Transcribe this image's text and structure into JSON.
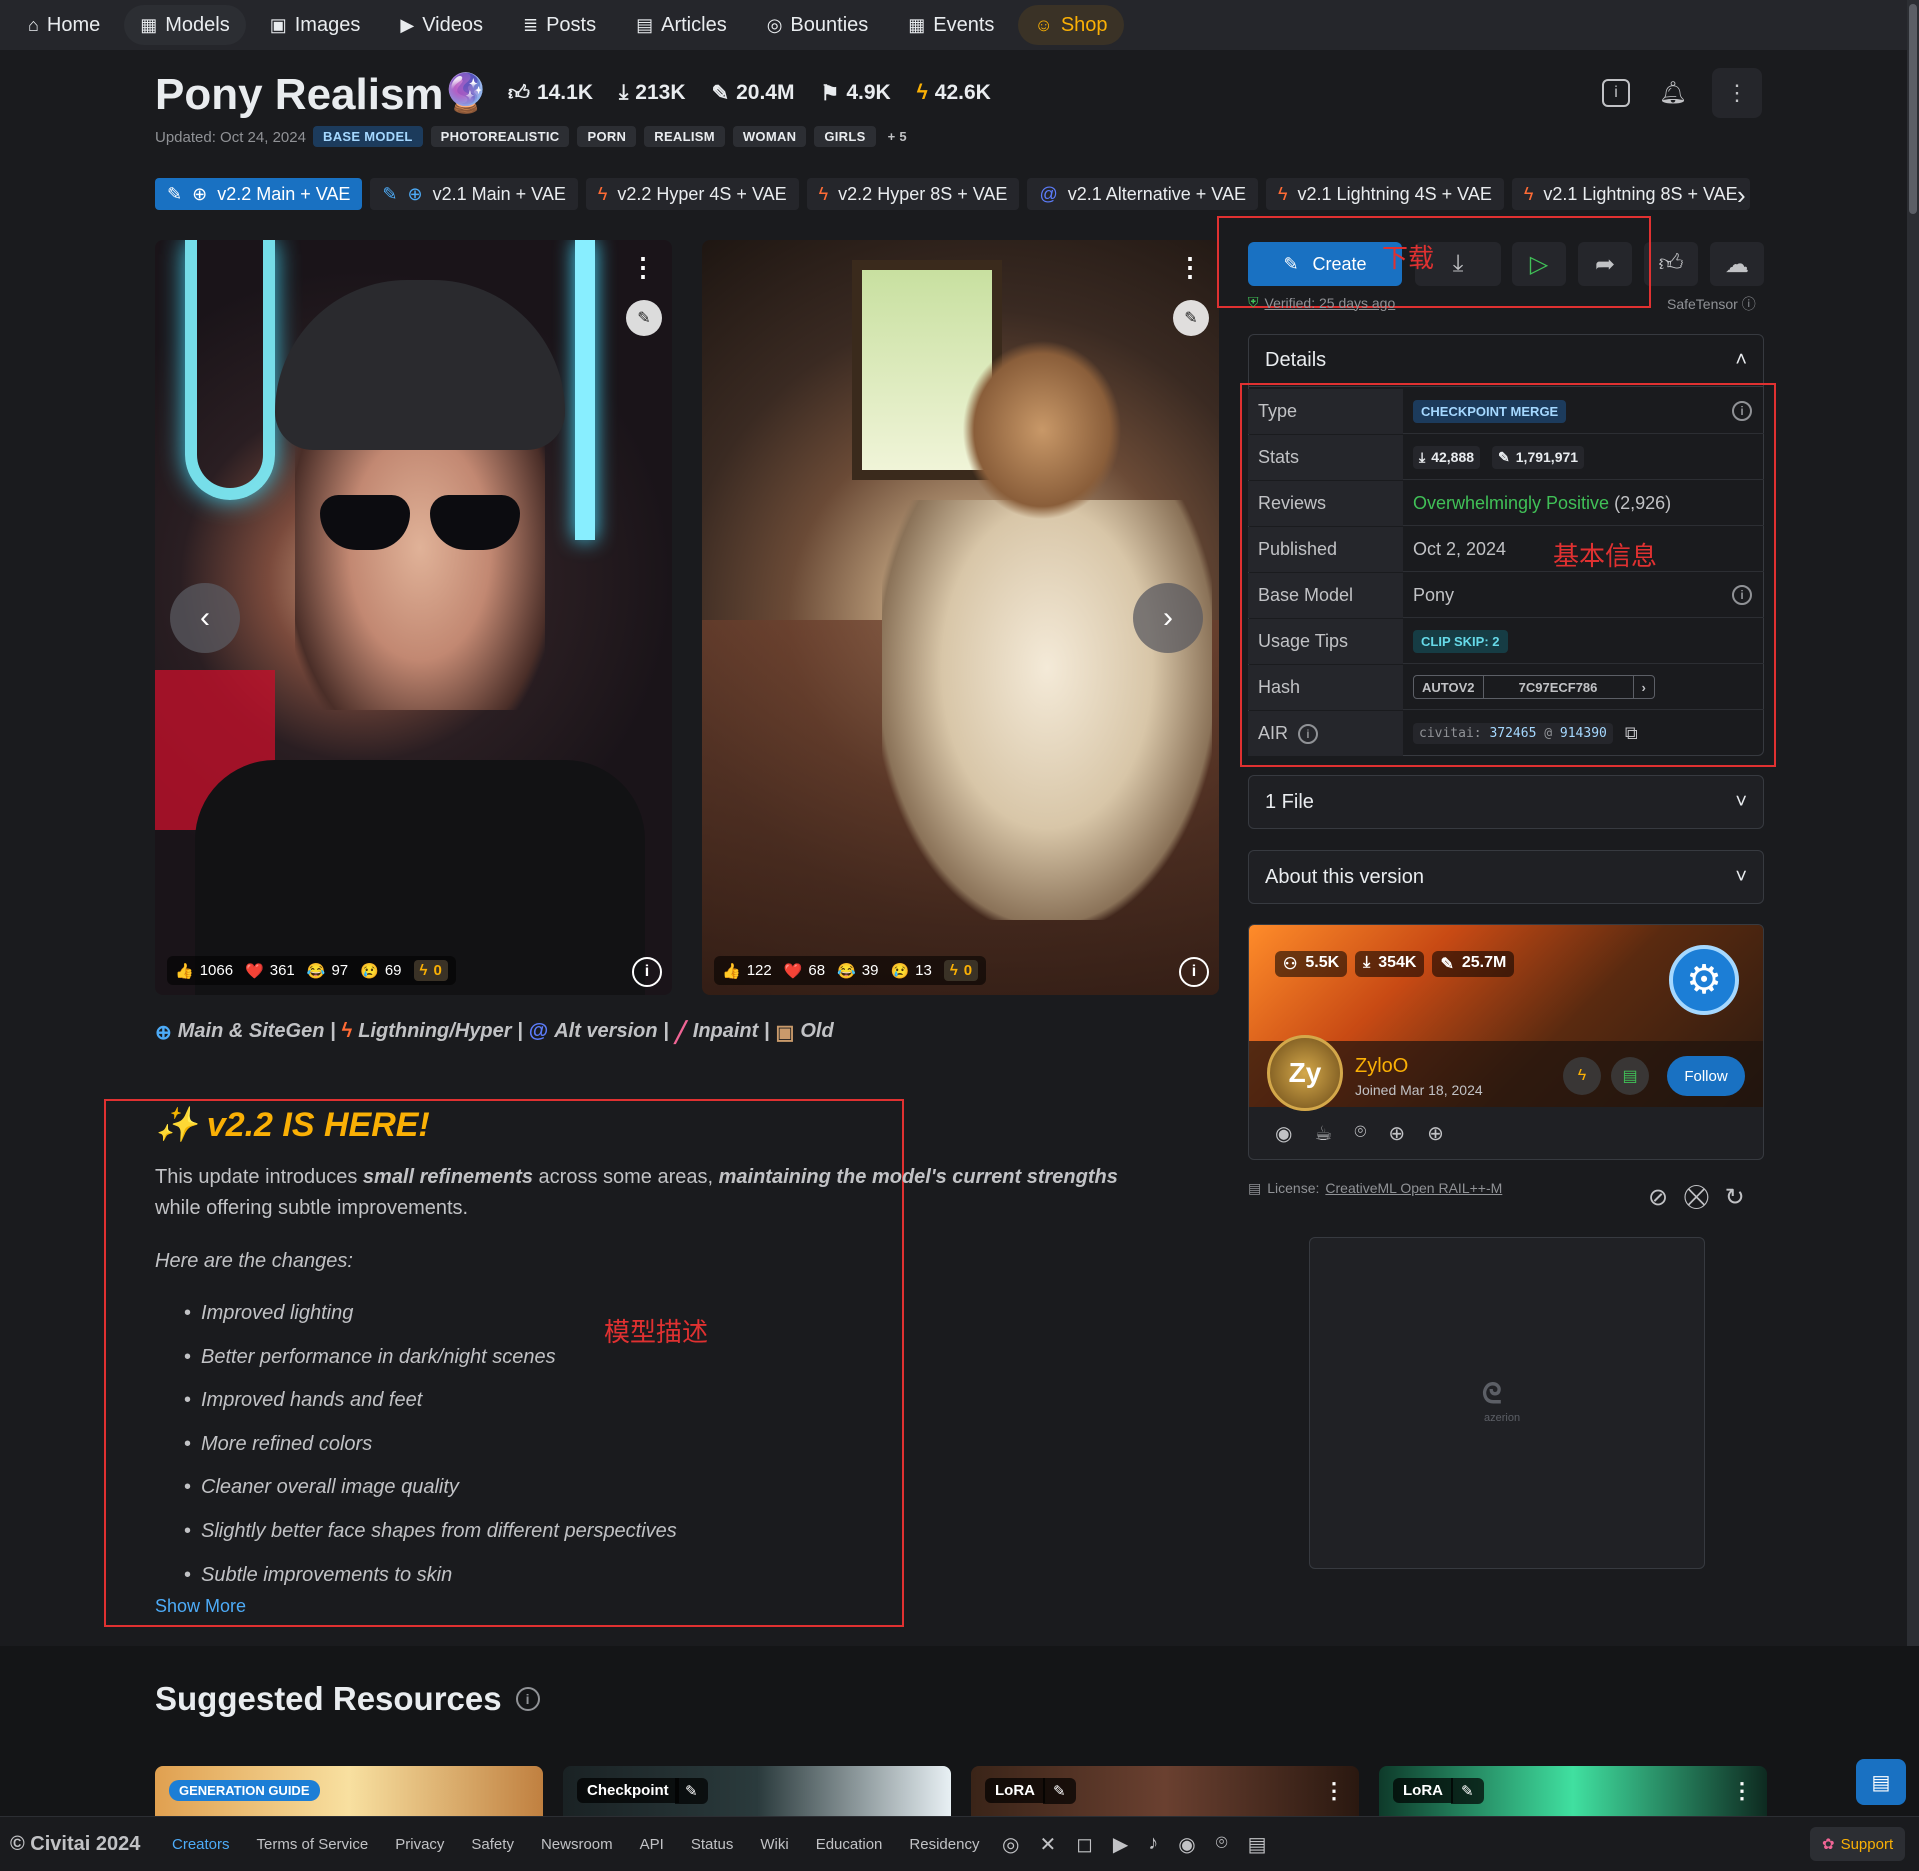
{
  "nav": [
    {
      "icon": "home-icon",
      "glyph": "⌂",
      "label": "Home"
    },
    {
      "icon": "grid-icon",
      "glyph": "▦",
      "label": "Models"
    },
    {
      "icon": "image-icon",
      "glyph": "▣",
      "label": "Images"
    },
    {
      "icon": "video-icon",
      "glyph": "▶",
      "label": "Videos"
    },
    {
      "icon": "posts-icon",
      "glyph": "≣",
      "label": "Posts"
    },
    {
      "icon": "article-icon",
      "glyph": "▤",
      "label": "Articles"
    },
    {
      "icon": "bounty-icon",
      "glyph": "◎",
      "label": "Bounties"
    },
    {
      "icon": "calendar-icon",
      "glyph": "▦",
      "label": "Events"
    },
    {
      "icon": "shop-icon",
      "glyph": "☺",
      "label": "Shop"
    }
  ],
  "model": {
    "title": "Pony Realism",
    "stats": {
      "likes": "14.1K",
      "downloads": "213K",
      "generations": "20.4M",
      "collected": "4.9K",
      "buzz": "42.6K"
    },
    "updated": "Updated: Oct 24, 2024",
    "tags": [
      "BASE MODEL",
      "PHOTOREALISTIC",
      "PORN",
      "REALISM",
      "WOMAN",
      "GIRLS",
      "+ 5"
    ]
  },
  "versions": [
    {
      "label": "v2.2 Main + VAE",
      "kind": "globe"
    },
    {
      "label": "v2.1 Main + VAE",
      "kind": "globe"
    },
    {
      "label": "v2.2 Hyper 4S + VAE",
      "kind": "bolt"
    },
    {
      "label": "v2.2 Hyper 8S + VAE",
      "kind": "bolt"
    },
    {
      "label": "v2.1 Alternative + VAE",
      "kind": "swirl"
    },
    {
      "label": "v2.1 Lightning 4S + VAE",
      "kind": "bolt"
    },
    {
      "label": "v2.1 Lightning 8S + VAE",
      "kind": "bolt"
    }
  ],
  "images": [
    {
      "reactions": {
        "like": "1066",
        "heart": "361",
        "laugh": "97",
        "cry": "69",
        "buzz": "0"
      }
    },
    {
      "reactions": {
        "like": "122",
        "heart": "68",
        "laugh": "39",
        "cry": "13",
        "buzz": "0"
      }
    }
  ],
  "categories": [
    "Main & SiteGen |",
    "Ligthning/Hyper |",
    "Alt version |",
    "Inpaint |",
    "Old"
  ],
  "description": {
    "title": "v2.2 IS HERE!",
    "intro_a": "This update introduces ",
    "intro_b": "small refinements",
    "intro_c": " across some areas, ",
    "intro_d": "maintaining the model's current strengths",
    "intro_e": " while offering subtle improvements.",
    "changes_heading": "Here are the changes:",
    "changes": [
      "Improved lighting",
      "Better performance in dark/night scenes",
      "Improved hands and feet",
      "More refined colors",
      "Cleaner overall image quality",
      "Slightly better face shapes from different perspectives",
      "Subtle improvements to skin"
    ],
    "show_more": "Show More"
  },
  "annotations": {
    "download": "下载",
    "basic_info": "基本信息",
    "model_desc": "模型描述"
  },
  "actions": {
    "create_label": "Create",
    "verified": "Verified: 25 days ago",
    "safetensor": "SafeTensor"
  },
  "details": {
    "heading": "Details",
    "rows": {
      "type_label": "Type",
      "type_value": "CHECKPOINT MERGE",
      "stats_label": "Stats",
      "stats_downloads": "42,888",
      "stats_generations": "1,791,971",
      "reviews_label": "Reviews",
      "reviews_value": "Overwhelmingly Positive",
      "reviews_count": "(2,926)",
      "published_label": "Published",
      "published_value": "Oct 2, 2024",
      "base_label": "Base Model",
      "base_value": "Pony",
      "usage_label": "Usage Tips",
      "usage_value": "CLIP SKIP: 2",
      "hash_label": "Hash",
      "hash_type": "AUTOV2",
      "hash_value": "7C97ECF786",
      "air_label": "AIR",
      "air_prefix": "civitai:",
      "air_model": "372465",
      "air_at": "@",
      "air_version": "914390"
    }
  },
  "files_heading": "1 File",
  "about_heading": "About this version",
  "creator": {
    "followers": "5.5K",
    "downloads": "354K",
    "generations": "25.7M",
    "name": "ZyloO",
    "joined": "Joined Mar 18, 2024",
    "follow": "Follow",
    "avatar_text": "Zy"
  },
  "license": {
    "prefix": "License:",
    "name": "CreativeML Open RAIL++-M"
  },
  "ad": {
    "logo": "ᘓ",
    "brand": "azerion"
  },
  "suggested": {
    "title": "Suggested Resources",
    "cards": [
      {
        "badge": "GENERATION GUIDE"
      },
      {
        "type": "Checkpoint"
      },
      {
        "type": "LoRA"
      },
      {
        "type": "LoRA"
      }
    ]
  },
  "footer": {
    "copyright": "© Civitai 2024",
    "links": [
      "Creators",
      "Terms of Service",
      "Privacy",
      "Safety",
      "Newsroom",
      "API",
      "Status",
      "Wiki",
      "Education",
      "Residency"
    ],
    "support": "Support"
  },
  "colors": {
    "accent": "#1971c2",
    "buzz": "#fab005",
    "annotation_red": "#e03131",
    "positive": "#40c057"
  }
}
